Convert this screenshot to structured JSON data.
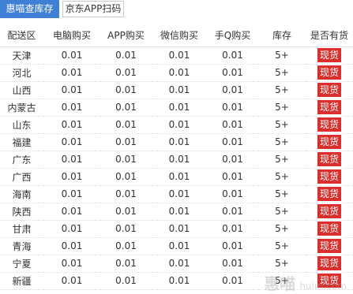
{
  "tabs": {
    "active_label": "惠喵查库存",
    "qr_label": "京东APP扫码"
  },
  "table": {
    "headers": [
      "配送区",
      "电脑购买",
      "APP购买",
      "微信购买",
      "手Q购买",
      "库存",
      "是否有货"
    ],
    "rows": [
      {
        "region": "天津",
        "pc": "0.01",
        "app": "0.01",
        "wechat": "0.01",
        "qq": "0.01",
        "stock": "5+",
        "status": "现货"
      },
      {
        "region": "河北",
        "pc": "0.01",
        "app": "0.01",
        "wechat": "0.01",
        "qq": "0.01",
        "stock": "5+",
        "status": "现货"
      },
      {
        "region": "山西",
        "pc": "0.01",
        "app": "0.01",
        "wechat": "0.01",
        "qq": "0.01",
        "stock": "5+",
        "status": "现货"
      },
      {
        "region": "内蒙古",
        "pc": "0.01",
        "app": "0.01",
        "wechat": "0.01",
        "qq": "0.01",
        "stock": "5+",
        "status": "现货"
      },
      {
        "region": "山东",
        "pc": "0.01",
        "app": "0.01",
        "wechat": "0.01",
        "qq": "0.01",
        "stock": "5+",
        "status": "现货"
      },
      {
        "region": "福建",
        "pc": "0.01",
        "app": "0.01",
        "wechat": "0.01",
        "qq": "0.01",
        "stock": "5+",
        "status": "现货"
      },
      {
        "region": "广东",
        "pc": "0.01",
        "app": "0.01",
        "wechat": "0.01",
        "qq": "0.01",
        "stock": "5+",
        "status": "现货"
      },
      {
        "region": "广西",
        "pc": "0.01",
        "app": "0.01",
        "wechat": "0.01",
        "qq": "0.01",
        "stock": "5+",
        "status": "现货"
      },
      {
        "region": "海南",
        "pc": "0.01",
        "app": "0.01",
        "wechat": "0.01",
        "qq": "0.01",
        "stock": "5+",
        "status": "现货"
      },
      {
        "region": "陕西",
        "pc": "0.01",
        "app": "0.01",
        "wechat": "0.01",
        "qq": "0.01",
        "stock": "5+",
        "status": "现货"
      },
      {
        "region": "甘肃",
        "pc": "0.01",
        "app": "0.01",
        "wechat": "0.01",
        "qq": "0.01",
        "stock": "5+",
        "status": "现货"
      },
      {
        "region": "青海",
        "pc": "0.01",
        "app": "0.01",
        "wechat": "0.01",
        "qq": "0.01",
        "stock": "5+",
        "status": "现货"
      },
      {
        "region": "宁夏",
        "pc": "0.01",
        "app": "0.01",
        "wechat": "0.01",
        "qq": "0.01",
        "stock": "5+",
        "status": "现货"
      },
      {
        "region": "新疆",
        "pc": "0.01",
        "app": "0.01",
        "wechat": "0.01",
        "qq": "0.01",
        "stock": "5+",
        "status": "现货"
      }
    ]
  },
  "watermark": {
    "brand_cn": "惠喵",
    "brand_en": "huim.com"
  },
  "colors": {
    "tab_active_bg": "#3f7fd6",
    "badge_bg": "#d9302e"
  }
}
